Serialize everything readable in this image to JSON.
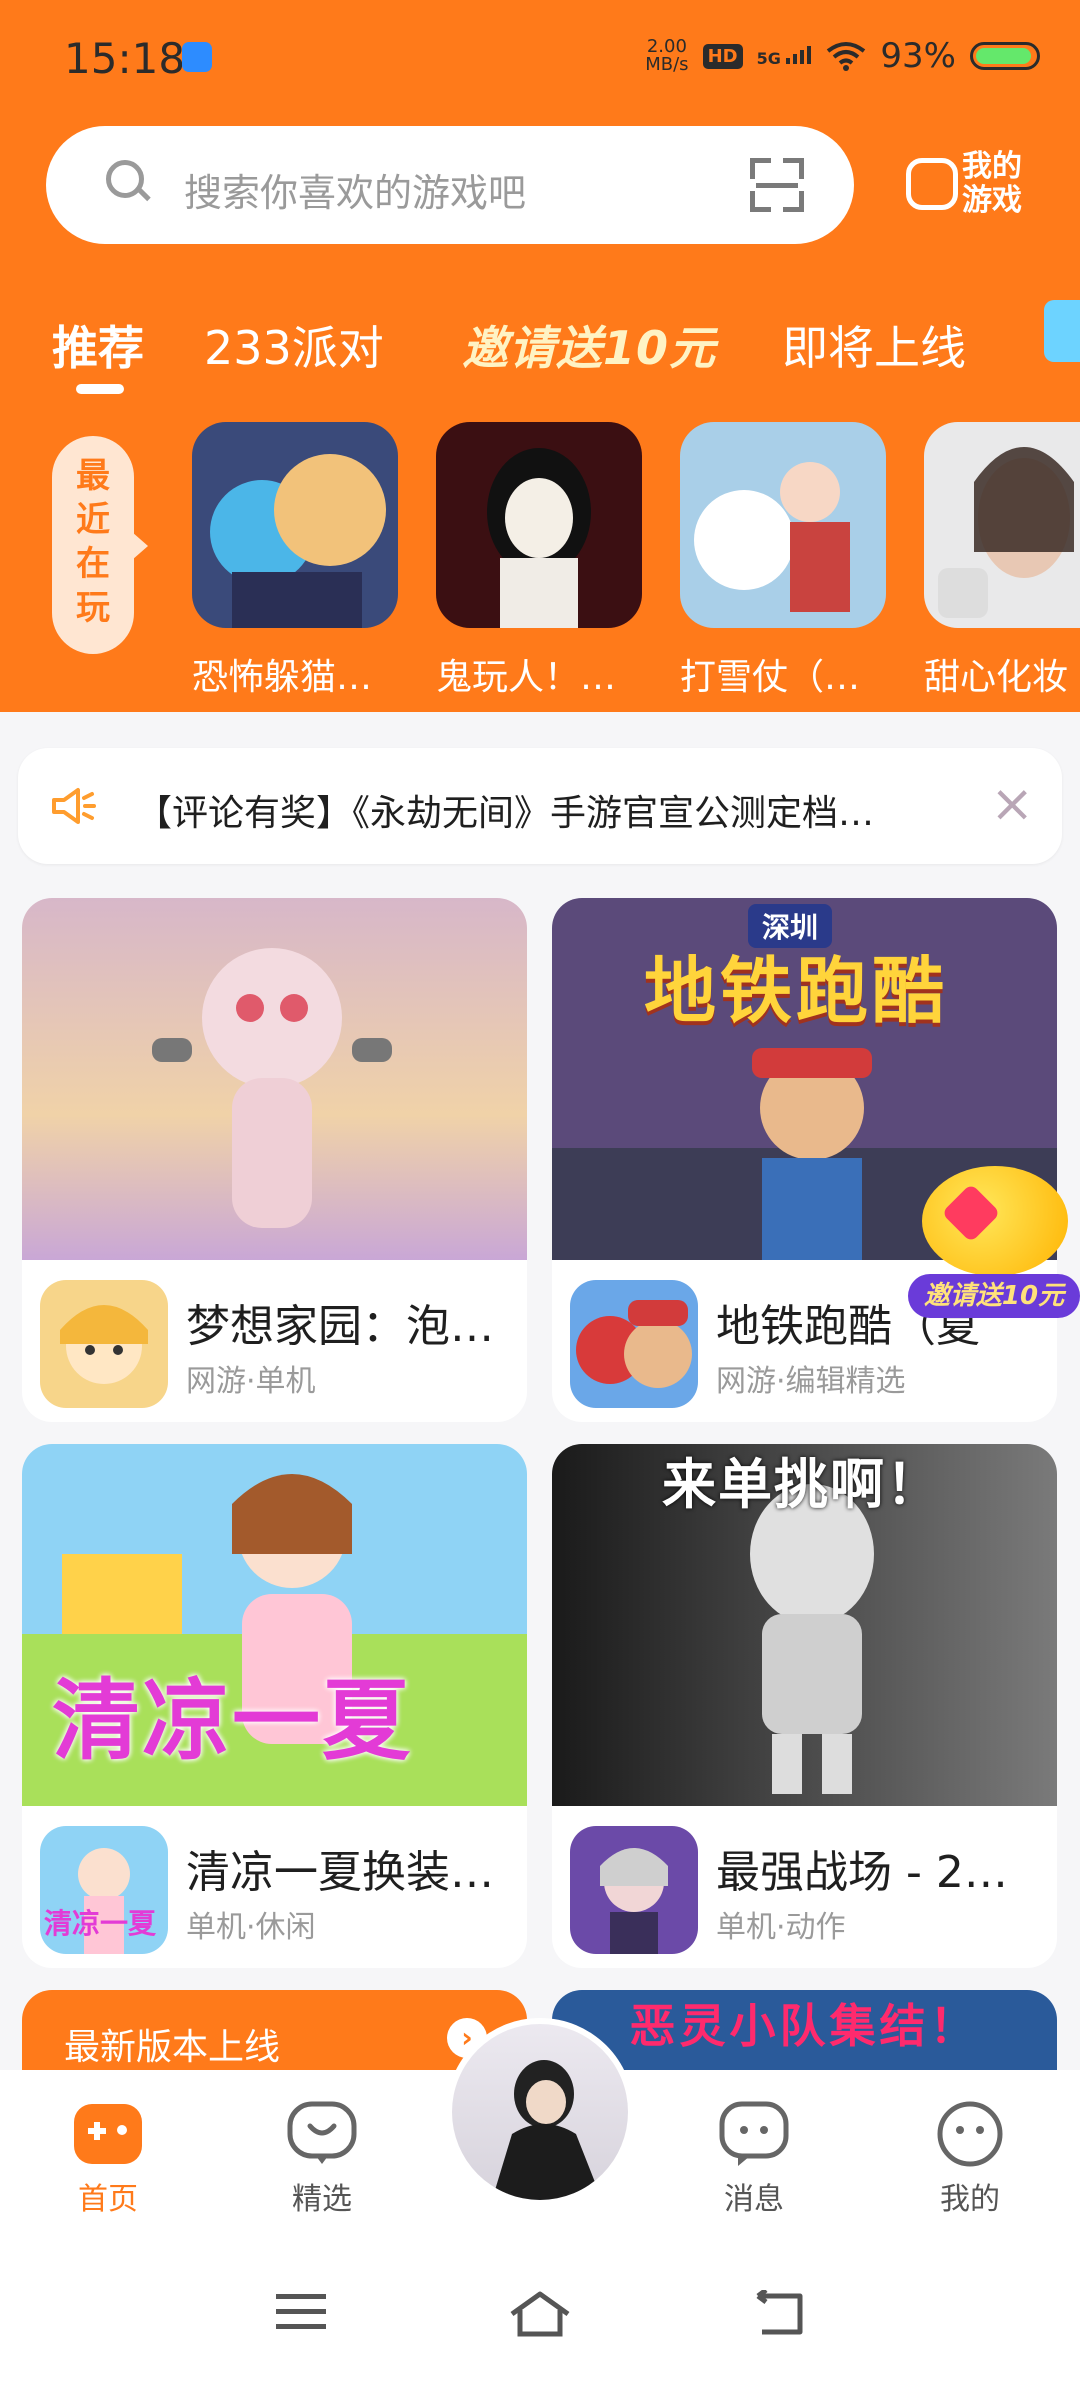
{
  "status_bar": {
    "time": "15:18",
    "net_speed_value": "2.00",
    "net_speed_unit": "MB/s",
    "hd": "HD",
    "network": "5G",
    "battery": "93%"
  },
  "search": {
    "placeholder": "搜索你喜欢的游戏吧",
    "my_games_line1": "我的",
    "my_games_line2": "游戏"
  },
  "tabs": [
    {
      "label": "推荐"
    },
    {
      "label": "233派对"
    },
    {
      "label": "邀请送10元"
    },
    {
      "label": "即将上线"
    }
  ],
  "recent": {
    "label": "最近在玩",
    "items": [
      {
        "name": "恐怖躲猫…"
      },
      {
        "name": "鬼玩人！…"
      },
      {
        "name": "打雪仗（…"
      },
      {
        "name": "甜心化妆"
      }
    ]
  },
  "notice": {
    "text": "【评论有奖】《永劫无间》手游官宣公测定档…"
  },
  "cards": [
    {
      "title": "梦想家园：泡…",
      "tags": "网游·单机"
    },
    {
      "title": "地铁跑酷（夏",
      "tags": "网游·编辑精选",
      "cover_text": "地铁跑酷",
      "cover_sub": "深圳"
    },
    {
      "title": "清凉一夏换装…",
      "tags": "单机·休闲",
      "cover_text": "清凉一夏",
      "icon_text": "清凉一夏"
    },
    {
      "title": "最强战场 - 2…",
      "tags": "单机·动作",
      "cover_text": "来单挑啊！"
    }
  ],
  "partial_cards": [
    {
      "title": "最新版本上线",
      "arrow": "›"
    },
    {
      "title": "恶灵小队集结！"
    }
  ],
  "invite_float": {
    "label": "邀请送10元"
  },
  "bottom_nav": [
    {
      "label": "首页"
    },
    {
      "label": "精选"
    },
    {
      "label": "消息"
    },
    {
      "label": "我的"
    }
  ],
  "colors": {
    "accent": "#ff7a1a",
    "background": "#f6f6f8"
  }
}
